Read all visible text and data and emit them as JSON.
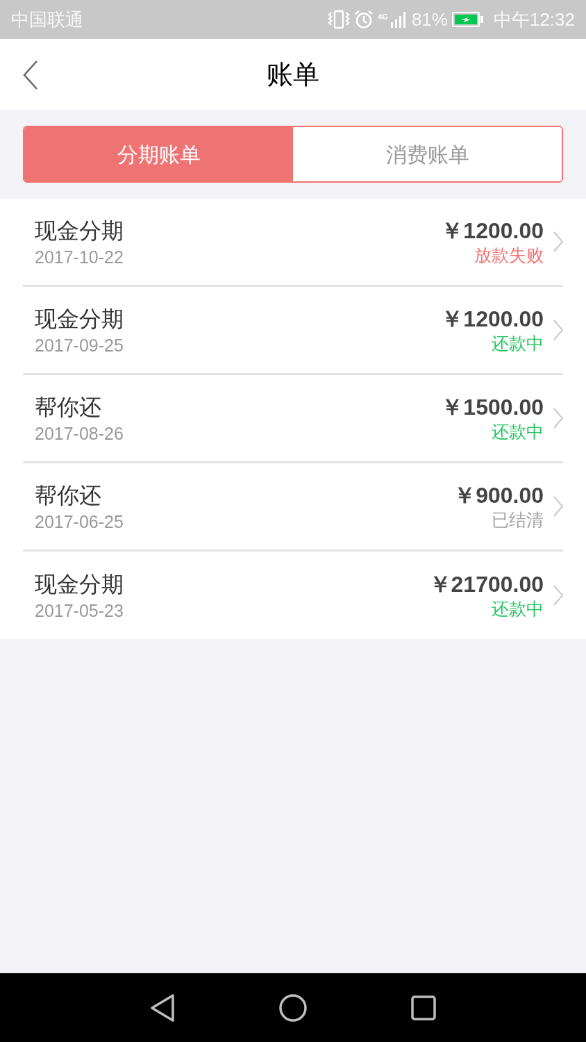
{
  "status_bar": {
    "carrier": "中国联通",
    "network": "4G",
    "battery": "81%",
    "time": "中午12:32"
  },
  "header": {
    "title": "账单"
  },
  "tabs": [
    {
      "label": "分期账单",
      "selected": true
    },
    {
      "label": "消费账单",
      "selected": false
    }
  ],
  "bills": [
    {
      "title": "现金分期",
      "date": "2017-10-22",
      "amount": "￥1200.00",
      "status": "放款失败",
      "color": "#f07374"
    },
    {
      "title": "现金分期",
      "date": "2017-09-25",
      "amount": "￥1200.00",
      "status": "还款中",
      "color": "#22c55e"
    },
    {
      "title": "帮你还",
      "date": "2017-08-26",
      "amount": "￥1500.00",
      "status": "还款中",
      "color": "#22c55e"
    },
    {
      "title": "帮你还",
      "date": "2017-06-25",
      "amount": "￥900.00",
      "status": "已结清",
      "color": "#a3a3a3"
    },
    {
      "title": "现金分期",
      "date": "2017-05-23",
      "amount": "￥21700.00",
      "status": "还款中",
      "color": "#22c55e"
    }
  ]
}
